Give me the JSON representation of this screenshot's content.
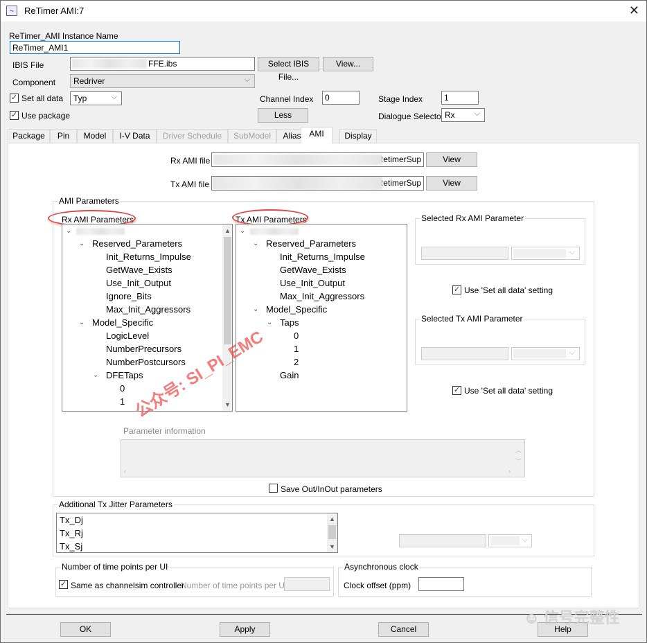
{
  "window": {
    "title": "ReTimer AMI:7",
    "icon": "waveform-app-icon",
    "close_icon": "close-icon"
  },
  "header": {
    "instance_name_label": "ReTimer_AMI Instance Name",
    "instance_name_value": "ReTimer_AMI1",
    "ibis_file_label": "IBIS File",
    "ibis_file_value": "FFE.ibs",
    "select_ibis_button": "Select IBIS File...",
    "view_button": "View...",
    "component_label": "Component",
    "component_value": "Redriver",
    "set_all_data_label": "Set all data",
    "set_all_data_checked": true,
    "set_all_data_value": "Typ",
    "use_package_label": "Use package",
    "use_package_checked": true,
    "channel_index_label": "Channel Index",
    "channel_index_value": "0",
    "stage_index_label": "Stage Index",
    "stage_index_value": "1",
    "less_button": "Less",
    "dialogue_selector_label": "Dialogue Selector",
    "dialogue_selector_value": "Rx"
  },
  "tabs": [
    {
      "label": "Package",
      "enabled": true
    },
    {
      "label": "Pin",
      "enabled": true
    },
    {
      "label": "Model",
      "enabled": true
    },
    {
      "label": "I-V Data",
      "enabled": true
    },
    {
      "label": "Driver Schedule",
      "enabled": false
    },
    {
      "label": "SubModel",
      "enabled": false
    },
    {
      "label": "Alias",
      "enabled": true
    },
    {
      "label": "AMI",
      "enabled": true,
      "active": true
    },
    {
      "label": "Display",
      "enabled": true
    }
  ],
  "ami": {
    "rx_file_label": "Rx AMI file",
    "rx_file_value": "_RetimerSup",
    "tx_file_label": "Tx AMI file",
    "tx_file_value": "_RetimerSup",
    "view_label": "View",
    "params_group_title": "AMI Parameters",
    "rx_tree_title": "Rx AMI Parameters",
    "tx_tree_title": "Tx AMI Parameters",
    "rx_tree": [
      {
        "label": "Reserved_Parameters",
        "level": 1,
        "expanded": true
      },
      {
        "label": "Init_Returns_Impulse",
        "level": 2
      },
      {
        "label": "GetWave_Exists",
        "level": 2
      },
      {
        "label": "Use_Init_Output",
        "level": 2
      },
      {
        "label": "Ignore_Bits",
        "level": 2
      },
      {
        "label": "Max_Init_Aggressors",
        "level": 2
      },
      {
        "label": "Model_Specific",
        "level": 1,
        "expanded": true
      },
      {
        "label": "LogicLevel",
        "level": 2
      },
      {
        "label": "NumberPrecursors",
        "level": 2
      },
      {
        "label": "NumberPostcursors",
        "level": 2
      },
      {
        "label": "DFETaps",
        "level": 2,
        "expanded": true
      },
      {
        "label": "0",
        "level": 3
      },
      {
        "label": "1",
        "level": 3
      }
    ],
    "tx_tree": [
      {
        "label": "Reserved_Parameters",
        "level": 1,
        "expanded": true
      },
      {
        "label": "Init_Returns_Impulse",
        "level": 2
      },
      {
        "label": "GetWave_Exists",
        "level": 2
      },
      {
        "label": "Use_Init_Output",
        "level": 2
      },
      {
        "label": "Max_Init_Aggressors",
        "level": 2
      },
      {
        "label": "Model_Specific",
        "level": 1,
        "expanded": true
      },
      {
        "label": "Taps",
        "level": 2,
        "expanded": true
      },
      {
        "label": "0",
        "level": 3
      },
      {
        "label": "1",
        "level": 3
      },
      {
        "label": "2",
        "level": 3
      },
      {
        "label": "Gain",
        "level": 2
      }
    ],
    "selected_rx_title": "Selected Rx AMI Parameter",
    "selected_tx_title": "Selected Tx AMI Parameter",
    "use_set_all_data_label": "Use 'Set all data' setting",
    "use_set_all_data_rx_checked": true,
    "use_set_all_data_tx_checked": true,
    "parameter_info_label": "Parameter information",
    "save_out_label": "Save Out/InOut parameters",
    "save_out_checked": false
  },
  "jitter": {
    "group_title": "Additional Tx Jitter Parameters",
    "items": [
      "Tx_Dj",
      "Tx_Rj",
      "Tx_Sj"
    ]
  },
  "time_points": {
    "group_title": "Number of time points per UI",
    "same_as_label": "Same as channelsim controller",
    "same_as_checked": true,
    "field_label": "Number of time points per UI"
  },
  "async_clock": {
    "group_title": "Asynchronous clock",
    "offset_label": "Clock offset (ppm)",
    "offset_value": ""
  },
  "footer": {
    "ok": "OK",
    "apply": "Apply",
    "cancel": "Cancel",
    "help": "Help"
  },
  "overlays": {
    "watermark_text": "公众号: SI_PI_EMC",
    "corner_watermark": "信号完整性",
    "accent_color": "#e04848"
  }
}
